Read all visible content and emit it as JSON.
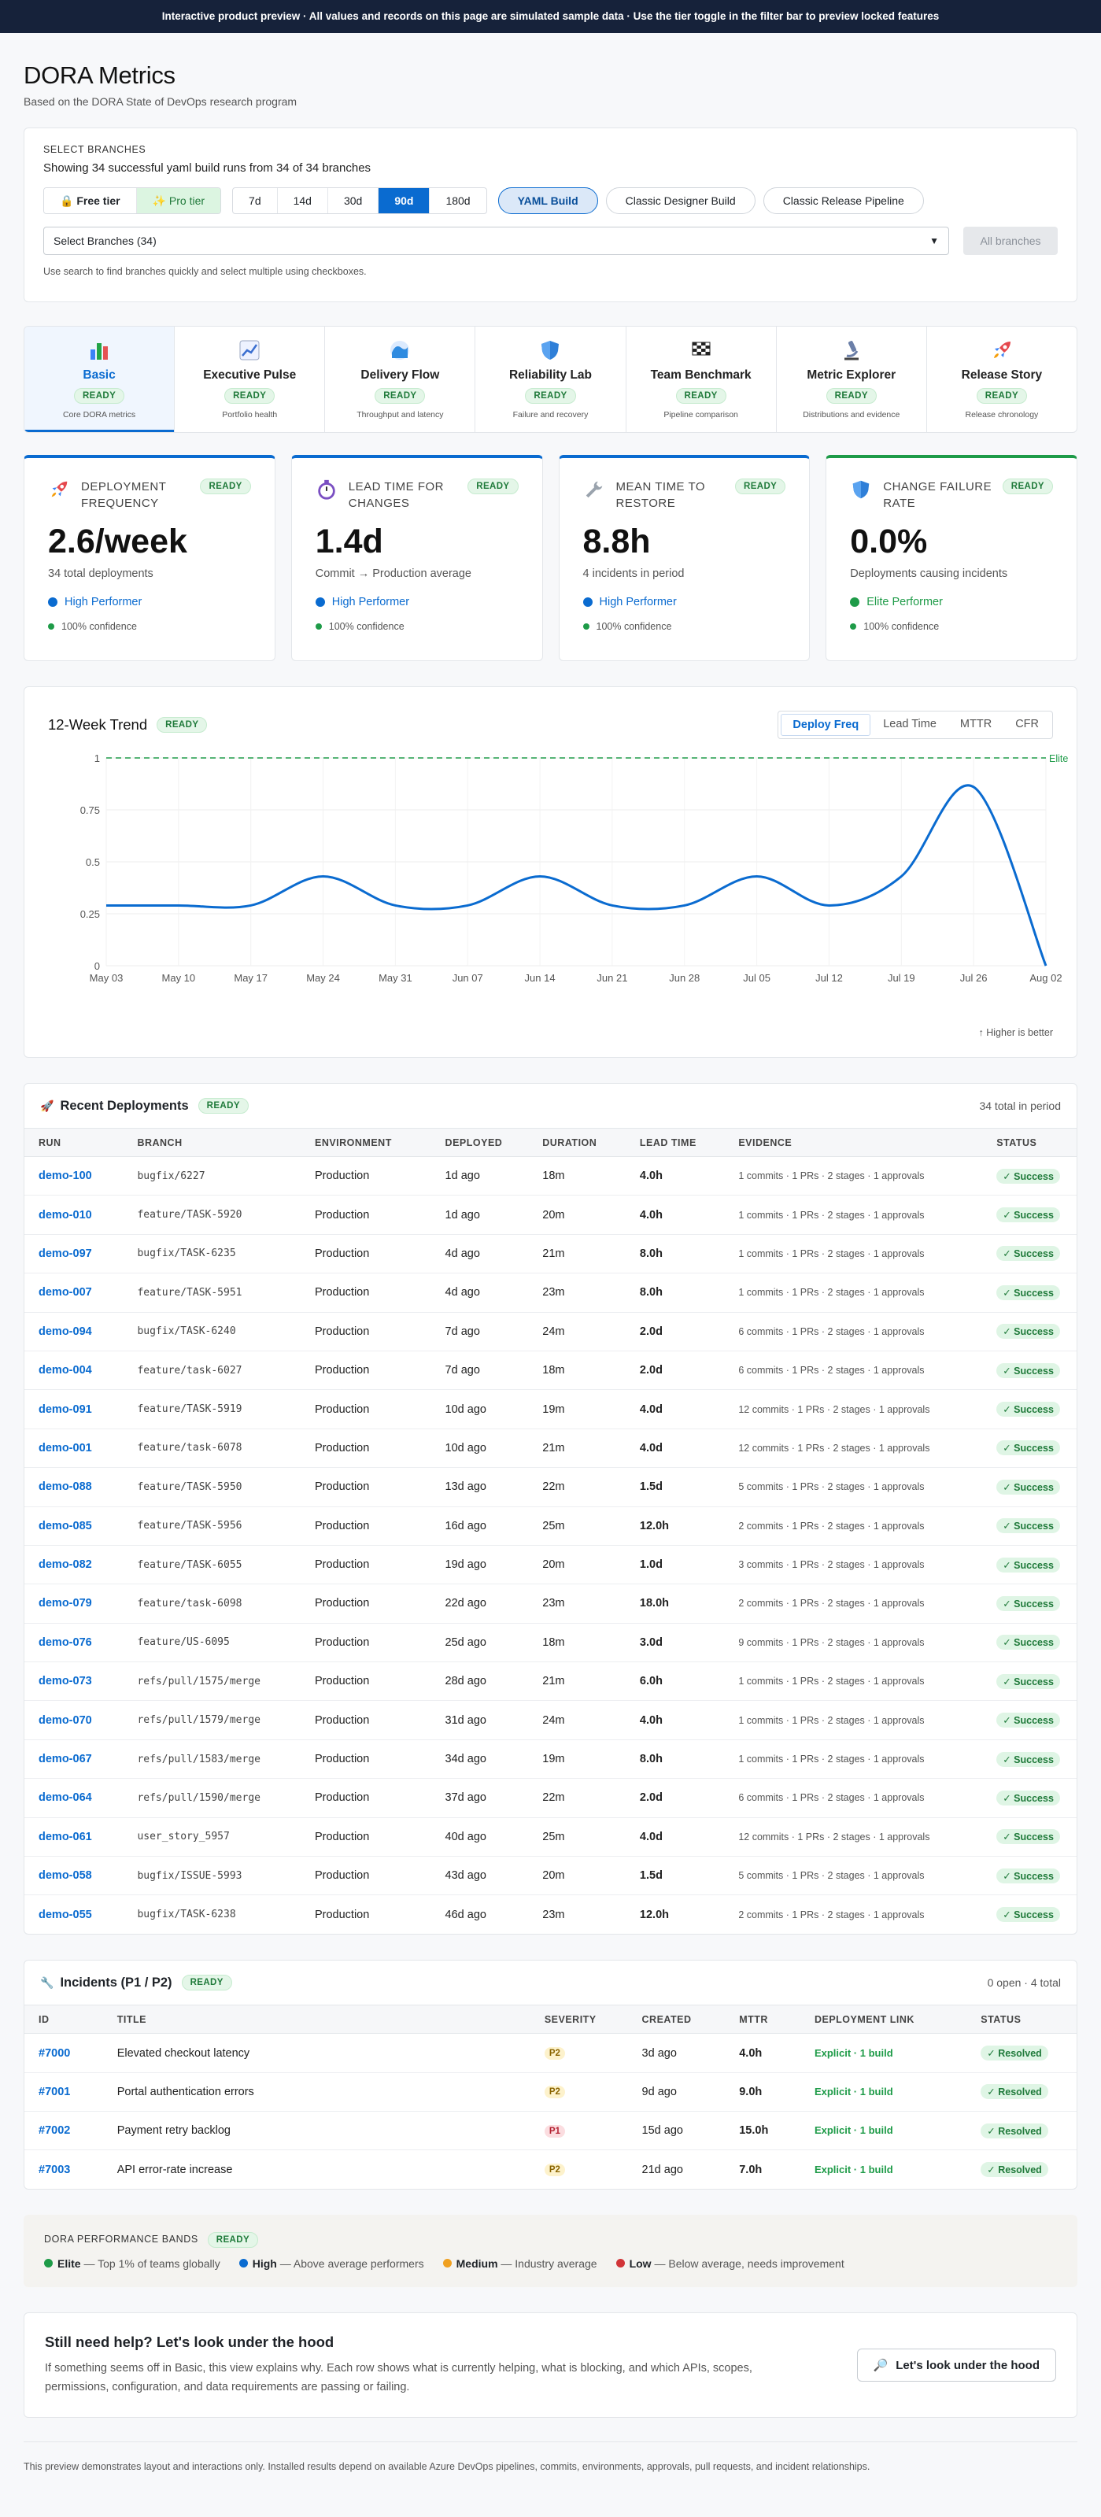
{
  "banner": "Interactive product preview · All values and records on this page are simulated sample data · Use the tier toggle in the filter bar to preview locked features",
  "header": {
    "title": "DORA Metrics",
    "subtitle": "Based on the DORA State of DevOps research program"
  },
  "branches": {
    "label": "SELECT BRANCHES",
    "info": "Showing 34 successful yaml build runs from 34 of 34 branches",
    "tiers": [
      "Free tier",
      "Pro tier"
    ],
    "periods": [
      "7d",
      "14d",
      "30d",
      "90d",
      "180d"
    ],
    "active_period": "90d",
    "sources": [
      "YAML Build",
      "Classic Designer Build",
      "Classic Release Pipeline"
    ],
    "select_value": "Select Branches (34)",
    "all_button": "All branches",
    "hint": "Use search to find branches quickly and select multiple using checkboxes."
  },
  "status_ready": "READY",
  "tabs": [
    {
      "title": "Basic",
      "sub": "Core DORA metrics",
      "icon": "bar-chart-icon"
    },
    {
      "title": "Executive Pulse",
      "sub": "Portfolio health",
      "icon": "trend-chart-icon"
    },
    {
      "title": "Delivery Flow",
      "sub": "Throughput and latency",
      "icon": "wave-icon"
    },
    {
      "title": "Reliability Lab",
      "sub": "Failure and recovery",
      "icon": "shield-icon"
    },
    {
      "title": "Team Benchmark",
      "sub": "Pipeline comparison",
      "icon": "checkered-flag-icon"
    },
    {
      "title": "Metric Explorer",
      "sub": "Distributions and evidence",
      "icon": "microscope-icon"
    },
    {
      "title": "Release Story",
      "sub": "Release chronology",
      "icon": "rocket-icon"
    }
  ],
  "kpis": [
    {
      "title": "DEPLOYMENT FREQUENCY",
      "value": "2.6/week",
      "sub": "34 total deployments",
      "perf": "High Performer",
      "conf": "100% confidence",
      "icon": "rocket-icon",
      "color": "#0a6bd0"
    },
    {
      "title": "LEAD TIME FOR CHANGES",
      "value": "1.4d",
      "sub": "Commit → Production average",
      "perf": "High Performer",
      "conf": "100% confidence",
      "icon": "stopwatch-icon",
      "color": "#0a6bd0"
    },
    {
      "title": "MEAN TIME TO RESTORE",
      "value": "8.8h",
      "sub": "4 incidents in period",
      "perf": "High Performer",
      "conf": "100% confidence",
      "icon": "wrench-icon",
      "color": "#0a6bd0"
    },
    {
      "title": "CHANGE FAILURE RATE",
      "value": "0.0%",
      "sub": "Deployments causing incidents",
      "perf": "Elite Performer",
      "conf": "100% confidence",
      "icon": "shield-icon",
      "color": "#1e9b48"
    }
  ],
  "trend": {
    "title": "12-Week Trend",
    "metric_tabs": [
      "Deploy Freq",
      "Lead Time",
      "MTTR",
      "CFR"
    ],
    "active_metric": "Deploy Freq",
    "elite_label": "Elite",
    "footnote": "↑ Higher is better"
  },
  "chart_data": {
    "type": "line",
    "x": [
      "May 03",
      "May 10",
      "May 17",
      "May 24",
      "May 31",
      "Jun 07",
      "Jun 14",
      "Jun 21",
      "Jun 28",
      "Jul 05",
      "Jul 12",
      "Jul 19",
      "Jul 26",
      "Aug 02"
    ],
    "values": [
      0.29,
      0.29,
      0.29,
      0.43,
      0.29,
      0.29,
      0.43,
      0.29,
      0.29,
      0.43,
      0.29,
      0.43,
      0.86,
      0.0
    ],
    "y_ticks": [
      0,
      0.25,
      0.5,
      0.75,
      1
    ],
    "ylim": [
      0,
      1
    ],
    "reference_line": 1,
    "grid": true,
    "line_color": "#0a6bd0",
    "reference_color": "#1e9b48"
  },
  "deployments": {
    "title": "Recent Deployments",
    "count": "34 total in period",
    "columns": [
      "RUN",
      "BRANCH",
      "ENVIRONMENT",
      "DEPLOYED",
      "DURATION",
      "LEAD TIME",
      "EVIDENCE",
      "STATUS"
    ],
    "rows": [
      [
        "demo-100",
        "bugfix/6227",
        "Production",
        "1d ago",
        "18m",
        "4.0h",
        "1 commits · 1 PRs · 2 stages · 1 approvals",
        "✓ Success"
      ],
      [
        "demo-010",
        "feature/TASK-5920",
        "Production",
        "1d ago",
        "20m",
        "4.0h",
        "1 commits · 1 PRs · 2 stages · 1 approvals",
        "✓ Success"
      ],
      [
        "demo-097",
        "bugfix/TASK-6235",
        "Production",
        "4d ago",
        "21m",
        "8.0h",
        "1 commits · 1 PRs · 2 stages · 1 approvals",
        "✓ Success"
      ],
      [
        "demo-007",
        "feature/TASK-5951",
        "Production",
        "4d ago",
        "23m",
        "8.0h",
        "1 commits · 1 PRs · 2 stages · 1 approvals",
        "✓ Success"
      ],
      [
        "demo-094",
        "bugfix/TASK-6240",
        "Production",
        "7d ago",
        "24m",
        "2.0d",
        "6 commits · 1 PRs · 2 stages · 1 approvals",
        "✓ Success"
      ],
      [
        "demo-004",
        "feature/task-6027",
        "Production",
        "7d ago",
        "18m",
        "2.0d",
        "6 commits · 1 PRs · 2 stages · 1 approvals",
        "✓ Success"
      ],
      [
        "demo-091",
        "feature/TASK-5919",
        "Production",
        "10d ago",
        "19m",
        "4.0d",
        "12 commits · 1 PRs · 2 stages · 1 approvals",
        "✓ Success"
      ],
      [
        "demo-001",
        "feature/task-6078",
        "Production",
        "10d ago",
        "21m",
        "4.0d",
        "12 commits · 1 PRs · 2 stages · 1 approvals",
        "✓ Success"
      ],
      [
        "demo-088",
        "feature/TASK-5950",
        "Production",
        "13d ago",
        "22m",
        "1.5d",
        "5 commits · 1 PRs · 2 stages · 1 approvals",
        "✓ Success"
      ],
      [
        "demo-085",
        "feature/TASK-5956",
        "Production",
        "16d ago",
        "25m",
        "12.0h",
        "2 commits · 1 PRs · 2 stages · 1 approvals",
        "✓ Success"
      ],
      [
        "demo-082",
        "feature/TASK-6055",
        "Production",
        "19d ago",
        "20m",
        "1.0d",
        "3 commits · 1 PRs · 2 stages · 1 approvals",
        "✓ Success"
      ],
      [
        "demo-079",
        "feature/task-6098",
        "Production",
        "22d ago",
        "23m",
        "18.0h",
        "2 commits · 1 PRs · 2 stages · 1 approvals",
        "✓ Success"
      ],
      [
        "demo-076",
        "feature/US-6095",
        "Production",
        "25d ago",
        "18m",
        "3.0d",
        "9 commits · 1 PRs · 2 stages · 1 approvals",
        "✓ Success"
      ],
      [
        "demo-073",
        "refs/pull/1575/merge",
        "Production",
        "28d ago",
        "21m",
        "6.0h",
        "1 commits · 1 PRs · 2 stages · 1 approvals",
        "✓ Success"
      ],
      [
        "demo-070",
        "refs/pull/1579/merge",
        "Production",
        "31d ago",
        "24m",
        "4.0h",
        "1 commits · 1 PRs · 2 stages · 1 approvals",
        "✓ Success"
      ],
      [
        "demo-067",
        "refs/pull/1583/merge",
        "Production",
        "34d ago",
        "19m",
        "8.0h",
        "1 commits · 1 PRs · 2 stages · 1 approvals",
        "✓ Success"
      ],
      [
        "demo-064",
        "refs/pull/1590/merge",
        "Production",
        "37d ago",
        "22m",
        "2.0d",
        "6 commits · 1 PRs · 2 stages · 1 approvals",
        "✓ Success"
      ],
      [
        "demo-061",
        "user_story_5957",
        "Production",
        "40d ago",
        "25m",
        "4.0d",
        "12 commits · 1 PRs · 2 stages · 1 approvals",
        "✓ Success"
      ],
      [
        "demo-058",
        "bugfix/ISSUE-5993",
        "Production",
        "43d ago",
        "20m",
        "1.5d",
        "5 commits · 1 PRs · 2 stages · 1 approvals",
        "✓ Success"
      ],
      [
        "demo-055",
        "bugfix/TASK-6238",
        "Production",
        "46d ago",
        "23m",
        "12.0h",
        "2 commits · 1 PRs · 2 stages · 1 approvals",
        "✓ Success"
      ]
    ]
  },
  "incidents": {
    "title": "Incidents (P1 / P2)",
    "count": "0 open · 4 total",
    "columns": [
      "ID",
      "TITLE",
      "SEVERITY",
      "CREATED",
      "MTTR",
      "DEPLOYMENT LINK",
      "STATUS"
    ],
    "rows": [
      [
        "#7000",
        "Elevated checkout latency",
        "P2",
        "3d ago",
        "4.0h",
        "Explicit · 1 build",
        "✓ Resolved"
      ],
      [
        "#7001",
        "Portal authentication errors",
        "P2",
        "9d ago",
        "9.0h",
        "Explicit · 1 build",
        "✓ Resolved"
      ],
      [
        "#7002",
        "Payment retry backlog",
        "P1",
        "15d ago",
        "15.0h",
        "Explicit · 1 build",
        "✓ Resolved"
      ],
      [
        "#7003",
        "API error-rate increase",
        "P2",
        "21d ago",
        "7.0h",
        "Explicit · 1 build",
        "✓ Resolved"
      ]
    ]
  },
  "bands": {
    "title": "DORA PERFORMANCE BANDS",
    "items": [
      {
        "name": "Elite",
        "desc": "— Top 1% of teams globally",
        "color": "#1e9b48"
      },
      {
        "name": "High",
        "desc": "— Above average performers",
        "color": "#0a6bd0"
      },
      {
        "name": "Medium",
        "desc": "— Industry average",
        "color": "#f0a020"
      },
      {
        "name": "Low",
        "desc": "— Below average, needs improvement",
        "color": "#d13438"
      }
    ]
  },
  "help": {
    "title": "Still need help? Let's look under the hood",
    "text": "If something seems off in Basic, this view explains why. Each row shows what is currently helping, what is blocking, and which APIs, scopes, permissions, configuration, and data requirements are passing or failing.",
    "button": "Let's look under the hood"
  },
  "footer": "This preview demonstrates layout and interactions only. Installed results depend on available Azure DevOps pipelines, commits, environments, approvals, pull requests, and incident relationships."
}
